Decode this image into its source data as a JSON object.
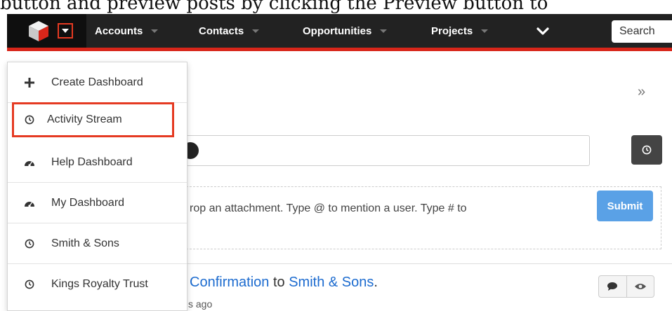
{
  "caption": "button and preview posts by clicking the Preview button to",
  "nav": {
    "items": [
      {
        "label": "Accounts"
      },
      {
        "label": "Contacts"
      },
      {
        "label": "Opportunities"
      },
      {
        "label": "Projects"
      }
    ],
    "search_label": "Search"
  },
  "dashboard_menu": {
    "items": [
      {
        "label": "Create Dashboard",
        "icon": "plus-icon"
      },
      {
        "label": "Activity Stream",
        "icon": "clock-icon",
        "highlighted": true
      },
      {
        "label": "Help Dashboard",
        "icon": "dashboard-gauge-icon"
      },
      {
        "label": "My Dashboard",
        "icon": "dashboard-gauge-icon"
      },
      {
        "label": "Smith & Sons",
        "icon": "clock-icon"
      },
      {
        "label": "Kings Royalty Trust",
        "icon": "clock-icon"
      }
    ]
  },
  "activity": {
    "post_hint": "rop an attachment. Type @ to mention a user. Type # to",
    "submit_label": "Submit",
    "entry_link1": "Confirmation",
    "entry_mid": " to ",
    "entry_link2": "Smith & Sons",
    "entry_end": ".",
    "entry_time": "s ago"
  },
  "colors": {
    "nav_bg": "#222222",
    "accent_red": "#e53a22",
    "submit_blue": "#5aa1e6",
    "link_blue": "#1c6bcf"
  }
}
